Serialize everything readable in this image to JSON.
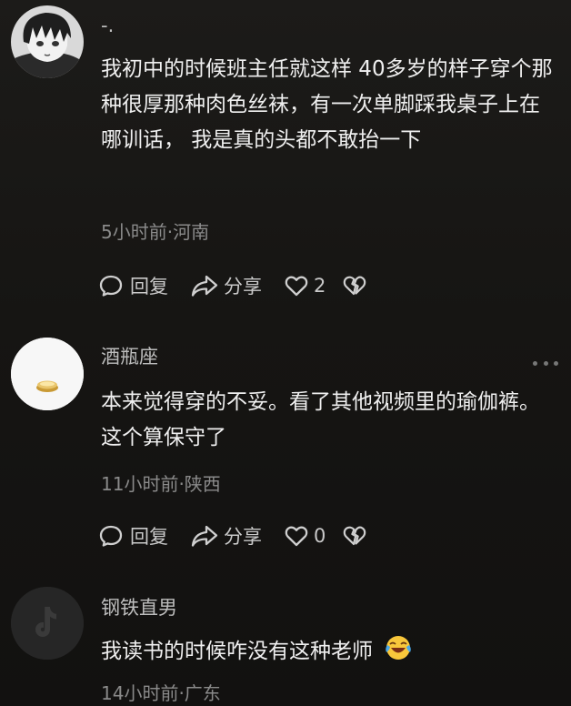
{
  "comments": [
    {
      "username": "-.",
      "text": "我初中的时候班主任就这样 40多岁的样子穿个那种很厚那种肉色丝袜，有一次单脚踩我桌子上在哪训话， 我是真的头都不敢抬一下",
      "meta": "5小时前·河南",
      "reply_label": "回复",
      "share_label": "分享",
      "like_count": "2"
    },
    {
      "username": "酒瓶座",
      "text": "本来觉得穿的不妥。看了其他视频里的瑜伽裤。这个算保守了",
      "meta": "11小时前·陕西",
      "reply_label": "回复",
      "share_label": "分享",
      "like_count": "0"
    },
    {
      "username": "钢铁直男",
      "text": "我读书的时候咋没有这种老师",
      "emoji": "🤣",
      "meta": "14小时前·广东"
    }
  ],
  "icons": {
    "reply": "comment-bubble-icon",
    "share": "share-arrow-icon",
    "like": "heart-outline-icon",
    "dislike": "broken-heart-icon",
    "more": "more-dots-icon"
  }
}
